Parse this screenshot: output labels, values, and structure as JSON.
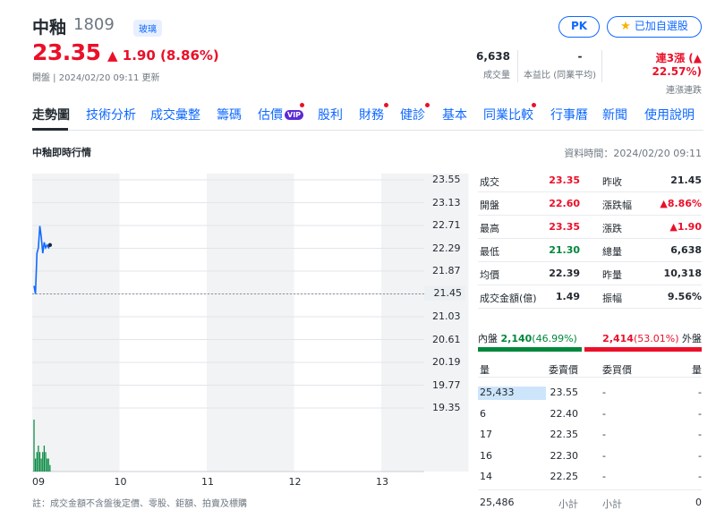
{
  "header": {
    "name": "中釉",
    "code": "1809",
    "industry": "玻璃",
    "price": "23.35",
    "change": "1.90 (8.86%)",
    "change_arrow": "▲",
    "status": "開盤",
    "updated": "2024/02/20 09:11 更新",
    "volume": {
      "value": "6,638",
      "label": "成交量"
    },
    "pe": {
      "value": "-",
      "label": "本益比 (同業平均)"
    },
    "streak": {
      "value": "連3漲 (▲ 22.57%)",
      "label": "連漲連跌"
    },
    "pk_label": "PK",
    "watch_label": "已加自選股"
  },
  "nav": {
    "items": [
      {
        "label": "走勢圖",
        "active": true
      },
      {
        "label": "技術分析"
      },
      {
        "label": "成交彙整"
      },
      {
        "label": "籌碼"
      },
      {
        "label": "估價",
        "badge": "VIP",
        "dot": true
      },
      {
        "label": "股利"
      },
      {
        "label": "財務",
        "dot": true
      },
      {
        "label": "健診",
        "dot": true
      },
      {
        "label": "基本"
      },
      {
        "label": "同業比較",
        "dot": true
      },
      {
        "label": "行事曆"
      },
      {
        "label": "新聞"
      },
      {
        "label": "使用說明"
      }
    ]
  },
  "section": {
    "title": "中釉即時行情",
    "data_time": "資料時間：2024/02/20 09:11"
  },
  "chart_data": {
    "type": "line",
    "x_ticks": [
      "09",
      "10",
      "11",
      "12",
      "13"
    ],
    "y_ticks": [
      "23.55",
      "23.13",
      "22.71",
      "22.29",
      "21.87",
      "21.45",
      "21.03",
      "20.61",
      "20.19",
      "19.77",
      "19.35"
    ],
    "ylim": [
      19.35,
      23.55
    ],
    "reference_price": 21.45,
    "reference_label": "21.45",
    "line_color": "#0f69ff",
    "volume_color": "#00873c",
    "series": [
      {
        "x": [
          "09:00",
          "09:01",
          "09:02",
          "09:03",
          "09:04",
          "09:05",
          "09:06",
          "09:07",
          "09:08",
          "09:09",
          "09:10",
          "09:11"
        ],
        "values": [
          21.6,
          21.45,
          22.2,
          22.3,
          22.7,
          22.5,
          22.2,
          22.4,
          22.3,
          22.35,
          22.3,
          22.35
        ]
      }
    ],
    "volume": [
      8,
      2,
      3,
      4,
      3,
      2,
      3,
      4,
      3,
      2,
      2,
      1
    ]
  },
  "stats": {
    "left": [
      {
        "label": "成交",
        "value": "23.35",
        "color": "red"
      },
      {
        "label": "開盤",
        "value": "22.60",
        "color": "red"
      },
      {
        "label": "最高",
        "value": "23.35",
        "color": "red"
      },
      {
        "label": "最低",
        "value": "21.30",
        "color": "green"
      },
      {
        "label": "均價",
        "value": "22.39",
        "color": "black"
      },
      {
        "label": "成交金額(億)",
        "value": "1.49",
        "color": "black"
      }
    ],
    "right": [
      {
        "label": "昨收",
        "value": "21.45",
        "color": "black"
      },
      {
        "label": "漲跌幅",
        "value": "▲8.86%",
        "color": "red"
      },
      {
        "label": "漲跌",
        "value": "▲1.90",
        "color": "red"
      },
      {
        "label": "總量",
        "value": "6,638",
        "color": "black"
      },
      {
        "label": "昨量",
        "value": "10,318",
        "color": "black"
      },
      {
        "label": "振幅",
        "value": "9.56%",
        "color": "black"
      }
    ]
  },
  "inout": {
    "in_label": "內盤",
    "in_value": "2,140",
    "in_pct": "(46.99%)",
    "out_value": "2,414",
    "out_pct": "(53.01%)",
    "out_label": "外盤"
  },
  "orderbook": {
    "headers": [
      "量",
      "委賣價",
      "委買價",
      "量"
    ],
    "rows": [
      {
        "vol": "25,433",
        "ask": "23.55",
        "bid": "-",
        "bvol": "-"
      },
      {
        "vol": "6",
        "ask": "22.40",
        "bid": "-",
        "bvol": "-"
      },
      {
        "vol": "17",
        "ask": "22.35",
        "bid": "-",
        "bvol": "-"
      },
      {
        "vol": "16",
        "ask": "22.30",
        "bid": "-",
        "bvol": "-"
      },
      {
        "vol": "14",
        "ask": "22.25",
        "bid": "-",
        "bvol": "-"
      }
    ],
    "total_ask": "25,486",
    "subtotal_label": "小計",
    "total_bid": "0"
  },
  "footnote": "註：成交金額不含盤後定價、零股、鉅額、拍賣及標購"
}
